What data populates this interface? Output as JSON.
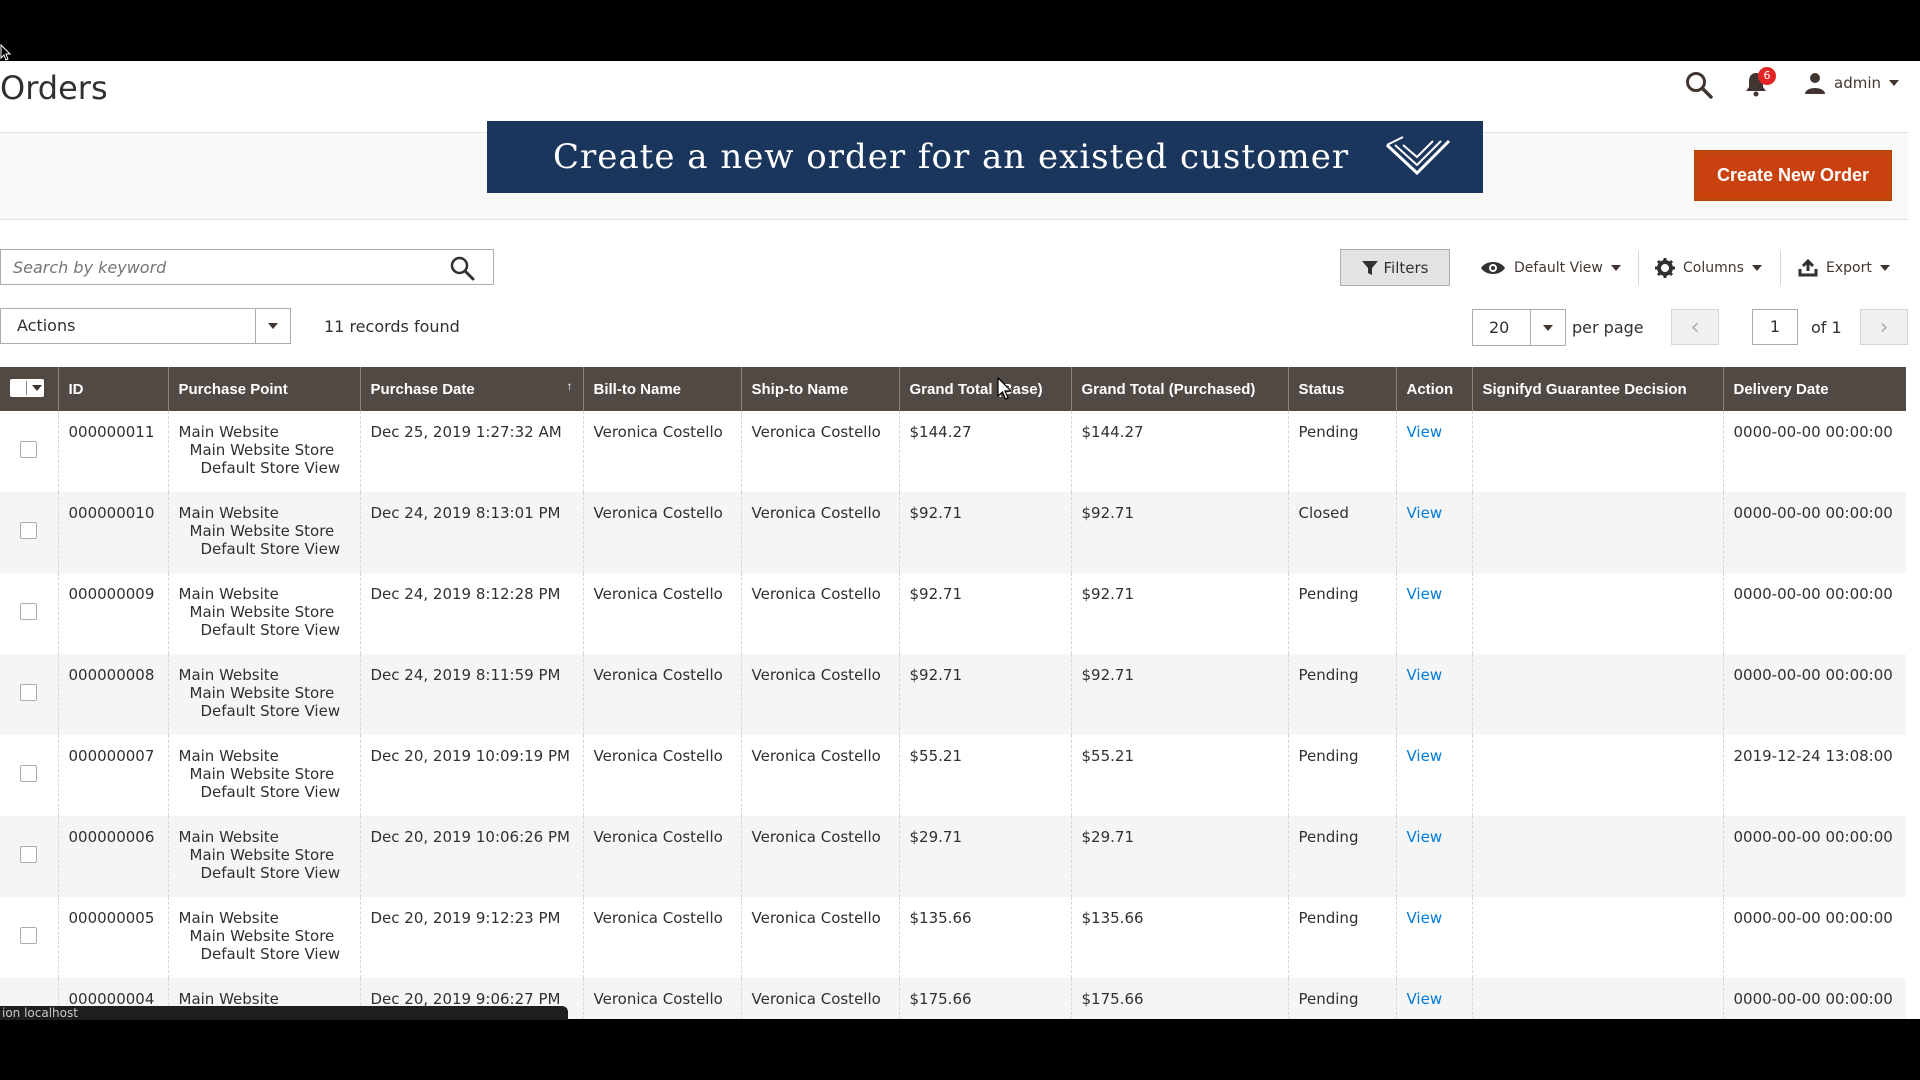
{
  "header": {
    "title": "Orders",
    "notification_count": "6",
    "user": "admin"
  },
  "banner": {
    "text": "Create a new order for an existed customer"
  },
  "create_button": "Create New Order",
  "toolbar": {
    "search_placeholder": "Search by keyword",
    "filters_label": "Filters",
    "view_label": "Default View",
    "columns_label": "Columns",
    "export_label": "Export",
    "actions_label": "Actions",
    "records_found": "11 records found",
    "per_page_value": "20",
    "per_page_label": "per page",
    "page_current": "1",
    "page_of": "of 1"
  },
  "grid": {
    "columns": [
      "ID",
      "Purchase Point",
      "Purchase Date",
      "Bill-to Name",
      "Ship-to Name",
      "Grand Total (Base)",
      "Grand Total (Purchased)",
      "Status",
      "Action",
      "Signifyd Guarantee Decision",
      "Delivery Date"
    ],
    "rows": [
      {
        "id": "000000011",
        "pp1": "Main Website",
        "pp2": "Main Website Store",
        "pp3": "Default Store View",
        "date": "Dec 25, 2019 1:27:32 AM",
        "bill": "Veronica Costello",
        "ship": "Veronica Costello",
        "base": "$144.27",
        "purchased": "$144.27",
        "status": "Pending",
        "action": "View",
        "signifyd": "",
        "delivery": "0000-00-00 00:00:00"
      },
      {
        "id": "000000010",
        "pp1": "Main Website",
        "pp2": "Main Website Store",
        "pp3": "Default Store View",
        "date": "Dec 24, 2019 8:13:01 PM",
        "bill": "Veronica Costello",
        "ship": "Veronica Costello",
        "base": "$92.71",
        "purchased": "$92.71",
        "status": "Closed",
        "action": "View",
        "signifyd": "",
        "delivery": "0000-00-00 00:00:00"
      },
      {
        "id": "000000009",
        "pp1": "Main Website",
        "pp2": "Main Website Store",
        "pp3": "Default Store View",
        "date": "Dec 24, 2019 8:12:28 PM",
        "bill": "Veronica Costello",
        "ship": "Veronica Costello",
        "base": "$92.71",
        "purchased": "$92.71",
        "status": "Pending",
        "action": "View",
        "signifyd": "",
        "delivery": "0000-00-00 00:00:00"
      },
      {
        "id": "000000008",
        "pp1": "Main Website",
        "pp2": "Main Website Store",
        "pp3": "Default Store View",
        "date": "Dec 24, 2019 8:11:59 PM",
        "bill": "Veronica Costello",
        "ship": "Veronica Costello",
        "base": "$92.71",
        "purchased": "$92.71",
        "status": "Pending",
        "action": "View",
        "signifyd": "",
        "delivery": "0000-00-00 00:00:00"
      },
      {
        "id": "000000007",
        "pp1": "Main Website",
        "pp2": "Main Website Store",
        "pp3": "Default Store View",
        "date": "Dec 20, 2019 10:09:19 PM",
        "bill": "Veronica Costello",
        "ship": "Veronica Costello",
        "base": "$55.21",
        "purchased": "$55.21",
        "status": "Pending",
        "action": "View",
        "signifyd": "",
        "delivery": "2019-12-24 13:08:00"
      },
      {
        "id": "000000006",
        "pp1": "Main Website",
        "pp2": "Main Website Store",
        "pp3": "Default Store View",
        "date": "Dec 20, 2019 10:06:26 PM",
        "bill": "Veronica Costello",
        "ship": "Veronica Costello",
        "base": "$29.71",
        "purchased": "$29.71",
        "status": "Pending",
        "action": "View",
        "signifyd": "",
        "delivery": "0000-00-00 00:00:00"
      },
      {
        "id": "000000005",
        "pp1": "Main Website",
        "pp2": "Main Website Store",
        "pp3": "Default Store View",
        "date": "Dec 20, 2019 9:12:23 PM",
        "bill": "Veronica Costello",
        "ship": "Veronica Costello",
        "base": "$135.66",
        "purchased": "$135.66",
        "status": "Pending",
        "action": "View",
        "signifyd": "",
        "delivery": "0000-00-00 00:00:00"
      },
      {
        "id": "000000004",
        "pp1": "Main Website",
        "pp2": "",
        "pp3": "",
        "date": "Dec 20, 2019 9:06:27 PM",
        "bill": "Veronica Costello",
        "ship": "Veronica Costello",
        "base": "$175.66",
        "purchased": "$175.66",
        "status": "Pending",
        "action": "View",
        "signifyd": "",
        "delivery": "0000-00-00 00:00:00"
      }
    ]
  },
  "status_bar": "ion localhost",
  "colors": {
    "header_bg": "#514943",
    "banner_bg": "#1a365d",
    "primary_button": "#c9410e",
    "link": "#007bdb",
    "badge": "#e22626"
  }
}
